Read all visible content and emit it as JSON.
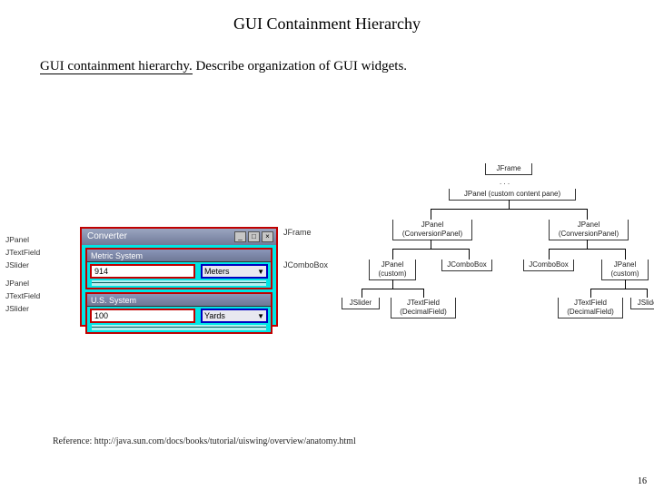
{
  "title": "GUI Containment Hierarchy",
  "subtitle_lead": "GUI containment hierarchy.",
  "subtitle_rest": "  Describe organization of GUI widgets.",
  "converter": {
    "titlebar": "Converter",
    "panel1": {
      "header": "Metric System",
      "value": "914",
      "unit": "Meters"
    },
    "panel2": {
      "header": "U.S. System",
      "value": "100",
      "unit": "Yards"
    }
  },
  "left_labels": {
    "g1a": "JPanel",
    "g1b": "JTextField",
    "g1c": "JSlider",
    "g2a": "JPanel",
    "g2b": "JTextField",
    "g2c": "JSlider"
  },
  "right_labels": {
    "a": "JFrame",
    "b": "JComboBox"
  },
  "tree": {
    "n1": "JFrame",
    "n1dots": ". . .",
    "n2": "JPanel (custom content pane)",
    "n3": "JPanel\n(ConversionPanel)",
    "n4": "JPanel\n(ConversionPanel)",
    "n5a": "JPanel\n(custom)",
    "n5b": "JComboBox",
    "n6a": "JComboBox",
    "n6b": "JPanel\n(custom)",
    "n7a": "JSlider",
    "n7b": "JTextField\n(DecimalField)",
    "n8a": "JTextField\n(DecimalField)",
    "n8b": "JSlider"
  },
  "reference": "Reference:  http://java.sun.com/docs/books/tutorial/uiswing/overview/anatomy.html",
  "page_number": "16"
}
